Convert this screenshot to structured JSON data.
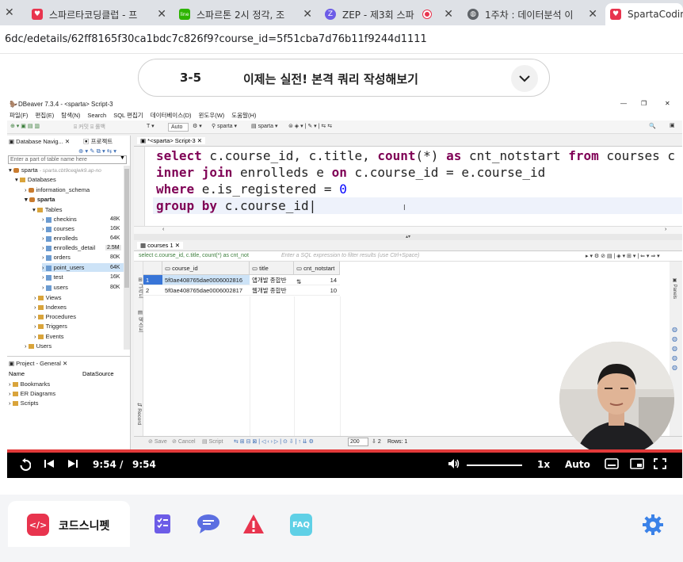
{
  "browser": {
    "tabs": [
      {
        "label": "스파르타코딩클럽 - 프",
        "fav_color": "#e8344e"
      },
      {
        "label": "스파르톤 2시 정각, 조",
        "fav_color": "#2db400"
      },
      {
        "label": "ZEP - 제3회 스파",
        "fav_color": "#6c5ce7"
      },
      {
        "label": "1주차 : 데이터분석 이",
        "fav_color": "#5f6368"
      },
      {
        "label": "SpartaCodin",
        "fav_color": "#e8344e"
      }
    ],
    "url": "6dc/edetails/62ff8165f30ca1bdc7c826f9?course_id=5f51cba7d76b11f9244d1111"
  },
  "lesson": {
    "number": "3-5",
    "title": "이제는 실전! 본격 쿼리 작성해보기",
    "toggle_icon": "chevron-down-icon"
  },
  "dbeaver": {
    "window_title": "DBeaver 7.3.4 - <sparta> Script-3",
    "menu": [
      "파일(F)",
      "편집(E)",
      "탐색(N)",
      "Search",
      "SQL 편집기",
      "데이터베이스(D)",
      "윈도우(W)",
      "도움말(H)"
    ],
    "toolbar": {
      "auto": "Auto",
      "schema1": "sparta",
      "schema2": "sparta"
    },
    "nav_tabs": {
      "navigator": "Database Navig...",
      "project": "프로젝트"
    },
    "nav_filter_placeholder": "Enter a part of table name here",
    "tree": {
      "connection": "sparta",
      "connection_host": "- sparta.cbt9ceqjwk9.ap-no",
      "databases": "Databases",
      "info_schema": "information_schema",
      "sparta_db": "sparta",
      "tables": "Tables",
      "table_list": [
        {
          "name": "checkins",
          "size": "48K"
        },
        {
          "name": "courses",
          "size": "16K"
        },
        {
          "name": "enrolleds",
          "size": "64K"
        },
        {
          "name": "enrolleds_detail",
          "size": "2.5M"
        },
        {
          "name": "orders",
          "size": "80K"
        },
        {
          "name": "point_users",
          "size": "64K"
        },
        {
          "name": "test",
          "size": "16K"
        },
        {
          "name": "users",
          "size": "80K"
        }
      ],
      "folders": [
        "Views",
        "Indexes",
        "Procedures",
        "Triggers",
        "Events"
      ],
      "users": "Users"
    },
    "project": {
      "tab": "Project - General",
      "col_name": "Name",
      "col_source": "DataSource",
      "items": [
        "Bookmarks",
        "ER Diagrams",
        "Scripts"
      ]
    },
    "editor_tab": "*<sparta> Script-3",
    "code": {
      "line1_kw1": "select",
      "line1_a": " c.course_id, c.title, ",
      "line1_kw2": "count",
      "line1_b": "(*) ",
      "line1_kw3": "as",
      "line1_c": " cnt_notstart ",
      "line1_kw4": "from",
      "line1_d": " courses c",
      "line2_kw1": "inner join",
      "line2_a": " enrolleds e ",
      "line2_kw2": "on",
      "line2_b": " c.course_id = e.course_id",
      "line3_kw1": "where",
      "line3_a": " e.is_registered = ",
      "line3_num": "0",
      "line4_kw1": "group by",
      "line4_a": " c.course_id"
    },
    "results_tab": "courses 1",
    "filter_query": "select c.course_id, c.title, count(*) as cnt_not",
    "filter_placeholder": "Enter a SQL expression to filter results (use Ctrl+Space)",
    "grid": {
      "columns": [
        "course_id",
        "title",
        "cnt_notstart"
      ],
      "rows": [
        {
          "num": "1",
          "course_id": "5f0ae408765dae0006002816",
          "title": "앱개발 종합반",
          "cnt": "14"
        },
        {
          "num": "2",
          "course_id": "5f0ae408765dae0006002817",
          "title": "웹개발 종합반",
          "cnt": "10"
        }
      ]
    },
    "status": {
      "save": "Save",
      "cancel": "Cancel",
      "script": "Script",
      "fetch": "200",
      "count": "2",
      "rows": "Rows: 1"
    }
  },
  "player": {
    "current_time": "9:54",
    "separator": "/",
    "total_time": "9:54",
    "speed": "1x",
    "quality": "Auto",
    "progress_fraction": 1.0
  },
  "bottom_bar": {
    "snippet_label": "코드스니펫",
    "snippet_icon_text": "</>",
    "faq": "FAQ"
  }
}
